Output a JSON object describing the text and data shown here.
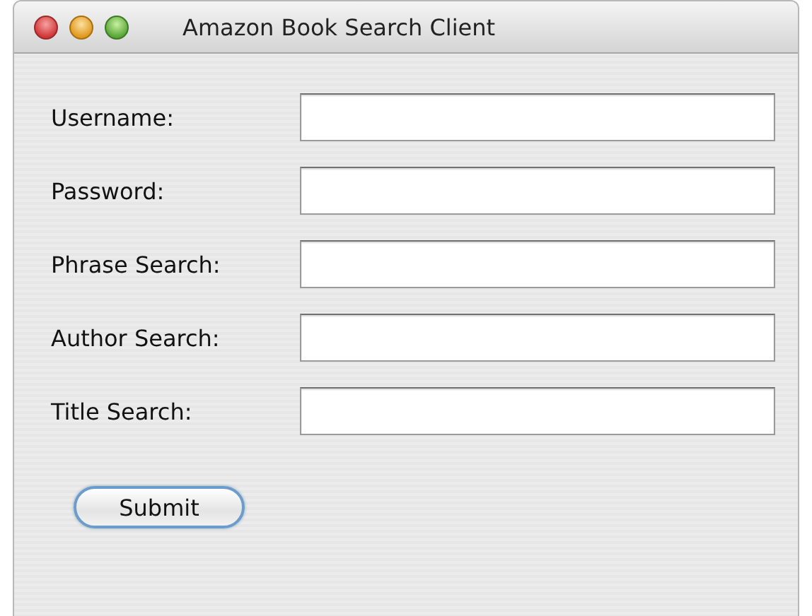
{
  "window": {
    "title": "Amazon Book Search Client"
  },
  "fields": [
    {
      "label": "Username:"
    },
    {
      "label": "Password:"
    },
    {
      "label": "Phrase Search:"
    },
    {
      "label": "Author Search:"
    },
    {
      "label": "Title Search:"
    }
  ],
  "buttons": [
    {
      "label": "Submit"
    }
  ]
}
